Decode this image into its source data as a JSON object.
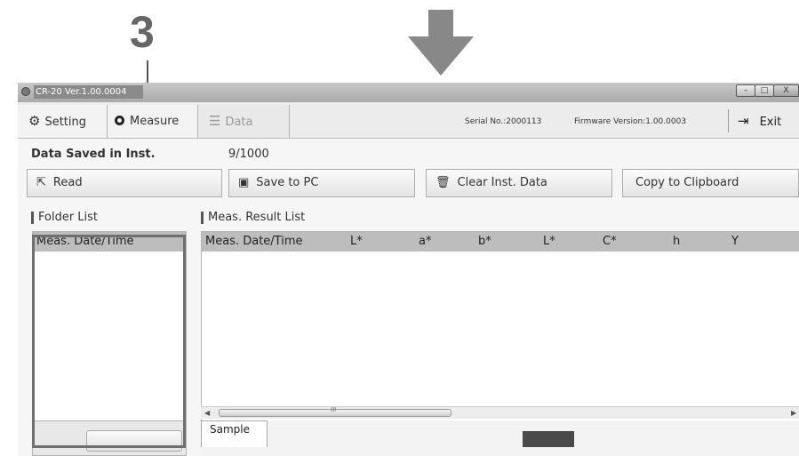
{
  "annotation": {
    "step_number": "3"
  },
  "window": {
    "title": "CR-20 Ver.1.00.0004",
    "controls": {
      "minimize": "–",
      "maximize": "□",
      "close": "X"
    }
  },
  "toolbar": {
    "tabs": [
      {
        "label": "Setting",
        "icon": "gear-icon"
      },
      {
        "label": "Measure",
        "icon": "measure-icon"
      },
      {
        "label": "Data",
        "icon": "list-icon"
      }
    ],
    "serial": "Serial No.:2000113",
    "firmware": "Firmware Version:1.00.0003",
    "exit_label": "Exit"
  },
  "data_saved": {
    "label": "Data Saved in Inst.",
    "count": "9/1000"
  },
  "buttons": {
    "read": "Read",
    "save": "Save to PC",
    "clear": "Clear Inst. Data",
    "copy": "Copy to Clipboard"
  },
  "folder_list": {
    "heading": "Folder List",
    "column": "Meas. Date/Time"
  },
  "result_list": {
    "heading": "Meas. Result List",
    "columns": [
      "Meas. Date/Time",
      "L*",
      "a*",
      "b*",
      "L*",
      "C*",
      "h",
      "Y"
    ]
  },
  "bottom": {
    "sample_tab": "Sample",
    "scroll_grip": "III"
  },
  "colors": {
    "arrow": "#888888",
    "annotation": "#666666"
  }
}
